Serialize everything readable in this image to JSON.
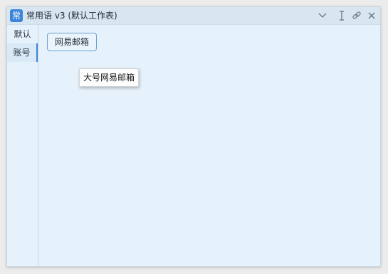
{
  "window": {
    "app_icon_glyph": "常",
    "title": "常用语 v3 (默认工作表)",
    "controls": {
      "collapse_icon": "chevron-down-icon",
      "resize_icon": "vertical-arrows-icon",
      "pin_icon": "link-icon",
      "close_icon": "close-icon"
    }
  },
  "sidebar": {
    "items": [
      {
        "label": "默认"
      },
      {
        "label": "账号"
      }
    ],
    "active_index": 1
  },
  "main": {
    "phrases": [
      {
        "label": "网易邮箱"
      }
    ],
    "tooltip": "大号网易邮箱"
  },
  "colors": {
    "accent": "#3d86d9",
    "window_bg": "#e6f2fb",
    "titlebar_bg": "#d8e6f1"
  }
}
